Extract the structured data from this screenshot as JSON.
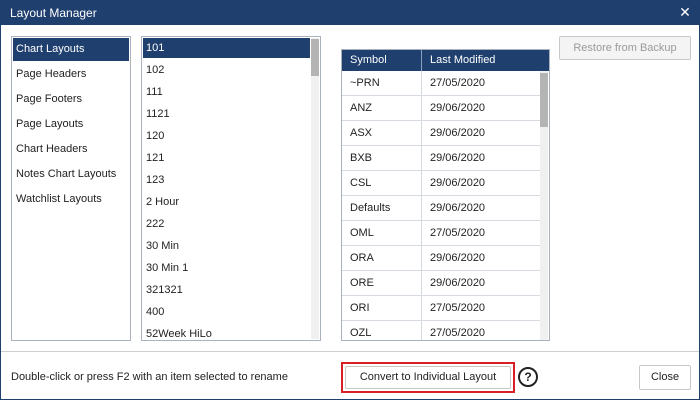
{
  "window": {
    "title": "Layout Manager",
    "close_glyph": "✕",
    "accent_color": "#1f3f6e"
  },
  "categories": [
    {
      "label": "Chart Layouts",
      "selected": true
    },
    {
      "label": "Page Headers",
      "selected": false
    },
    {
      "label": "Page Footers",
      "selected": false
    },
    {
      "label": "Page Layouts",
      "selected": false
    },
    {
      "label": "Chart Headers",
      "selected": false
    },
    {
      "label": "Notes Chart Layouts",
      "selected": false
    },
    {
      "label": "Watchlist Layouts",
      "selected": false
    }
  ],
  "layouts": [
    {
      "label": "101",
      "selected": true
    },
    {
      "label": "102",
      "selected": false
    },
    {
      "label": "111",
      "selected": false
    },
    {
      "label": "1121",
      "selected": false
    },
    {
      "label": "120",
      "selected": false
    },
    {
      "label": "121",
      "selected": false
    },
    {
      "label": "123",
      "selected": false
    },
    {
      "label": "2 Hour",
      "selected": false
    },
    {
      "label": "222",
      "selected": false
    },
    {
      "label": "30 Min",
      "selected": false
    },
    {
      "label": "30 Min 1",
      "selected": false
    },
    {
      "label": "321321",
      "selected": false
    },
    {
      "label": "400",
      "selected": false
    },
    {
      "label": "52Week HiLo",
      "selected": false
    }
  ],
  "table": {
    "headers": [
      "Symbol",
      "Last Modified"
    ],
    "rows": [
      [
        "~PRN",
        "27/05/2020"
      ],
      [
        "ANZ",
        "29/06/2020"
      ],
      [
        "ASX",
        "29/06/2020"
      ],
      [
        "BXB",
        "29/06/2020"
      ],
      [
        "CSL",
        "29/06/2020"
      ],
      [
        "Defaults",
        "29/06/2020"
      ],
      [
        "OML",
        "27/05/2020"
      ],
      [
        "ORA",
        "29/06/2020"
      ],
      [
        "ORE",
        "29/06/2020"
      ],
      [
        "ORI",
        "27/05/2020"
      ],
      [
        "OZL",
        "27/05/2020"
      ]
    ]
  },
  "buttons": {
    "restore": "Restore from Backup",
    "convert": "Convert to Individual Layout",
    "help": "?",
    "close": "Close"
  },
  "footer": {
    "hint": "Double-click or press F2 with an item selected to rename"
  }
}
